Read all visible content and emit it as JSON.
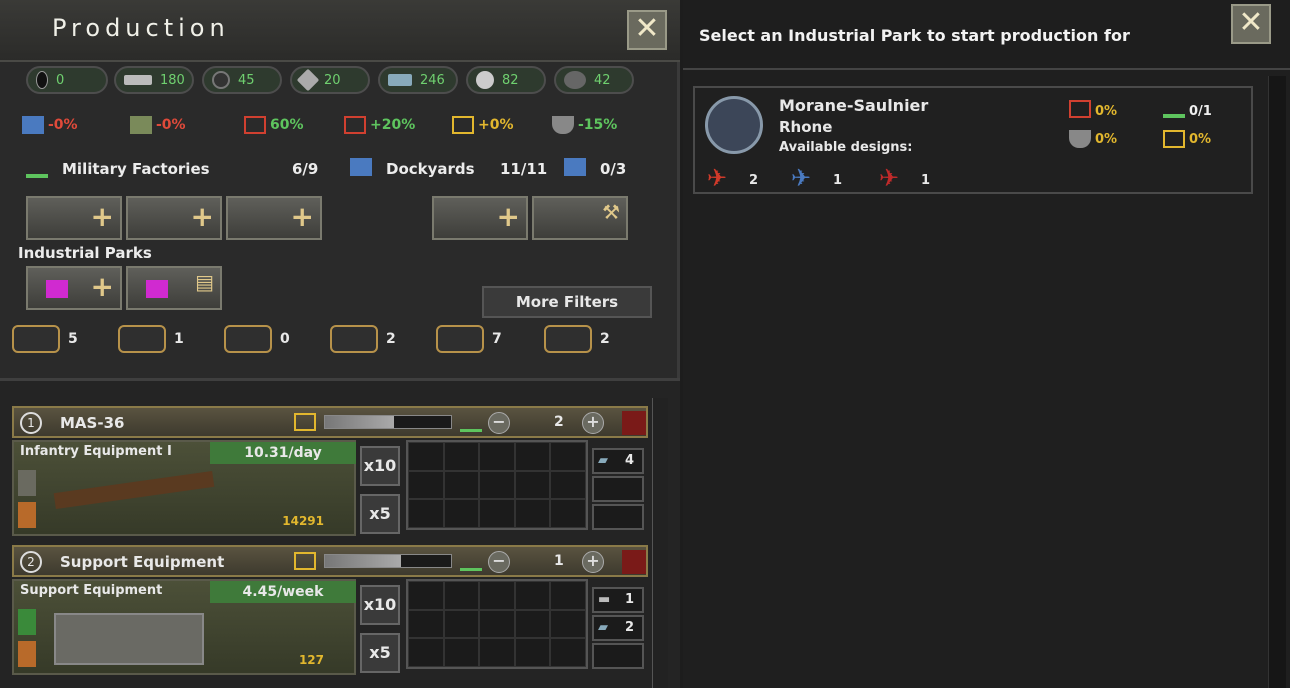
{
  "production": {
    "title": "Production",
    "resources": [
      {
        "icon": "oil-icon",
        "value": "0"
      },
      {
        "icon": "aluminium-icon",
        "value": "180"
      },
      {
        "icon": "rubber-icon",
        "value": "45"
      },
      {
        "icon": "tungsten-icon",
        "value": "20"
      },
      {
        "icon": "steel-icon",
        "value": "246"
      },
      {
        "icon": "chromium-icon",
        "value": "82"
      },
      {
        "icon": "fuel-icon",
        "value": "42"
      }
    ],
    "stats": [
      {
        "icon": "dockyard-output-icon",
        "value": "-0%",
        "color": "#e04a3a"
      },
      {
        "icon": "support-output-icon",
        "value": "-0%",
        "color": "#e04a3a"
      },
      {
        "icon": "factory-efficiency-icon",
        "value": "60%",
        "color": "#5ec45e"
      },
      {
        "icon": "efficiency-growth-icon",
        "value": "+20%",
        "color": "#5ec45e"
      },
      {
        "icon": "efficiency-retention-icon",
        "value": "+0%",
        "color": "#e2b72e"
      },
      {
        "icon": "resource-usage-icon",
        "value": "-15%",
        "color": "#5ec45e"
      }
    ],
    "military_factories_label": "Military Factories",
    "military_factories_value": "6/9",
    "dockyards_label": "Dockyards",
    "dockyards_value": "11/11",
    "naval_repair_value": "0/3",
    "industrial_parks_label": "Industrial Parks",
    "more_filters": "More Filters",
    "categories": [
      {
        "icon": "infantry-category-icon",
        "count": "5"
      },
      {
        "icon": "armor-category-icon",
        "count": "1"
      },
      {
        "icon": "air-category-icon",
        "count": "0"
      },
      {
        "icon": "naval-air-category-icon",
        "count": "2"
      },
      {
        "icon": "naval-category-icon",
        "count": "7"
      },
      {
        "icon": "train-category-icon",
        "count": "2"
      }
    ],
    "queue": [
      {
        "index": "1",
        "name": "MAS-36",
        "assigned": "2",
        "equipment": "Infantry Equipment I",
        "rate": "10.31/day",
        "stock": "14291",
        "progress": 0.55,
        "mult10": "x10",
        "mult5": "x5",
        "resources": [
          {
            "icon": "steel-icon",
            "value": "4"
          }
        ]
      },
      {
        "index": "2",
        "name": "Support Equipment",
        "assigned": "1",
        "equipment": "Support Equipment",
        "rate": "4.45/week",
        "stock": "127",
        "progress": 0.6,
        "mult10": "x10",
        "mult5": "x5",
        "resources": [
          {
            "icon": "aluminium-icon",
            "value": "1"
          },
          {
            "icon": "steel-icon",
            "value": "2"
          }
        ]
      }
    ]
  },
  "park_select": {
    "title": "Select an Industrial Park to start production for",
    "company": {
      "name": "Morane-Saulnier",
      "subtitle": "Rhone",
      "designs_label": "Available designs:",
      "stat_efficiency": "0%",
      "stat_factories": "0/1",
      "stat_support": "0%",
      "stat_retention": "0%",
      "designs": [
        {
          "icon": "fighter-red-icon",
          "count": "2"
        },
        {
          "icon": "fighter-blue-icon",
          "count": "1"
        },
        {
          "icon": "fighter-red2-icon",
          "count": "1"
        }
      ]
    }
  }
}
